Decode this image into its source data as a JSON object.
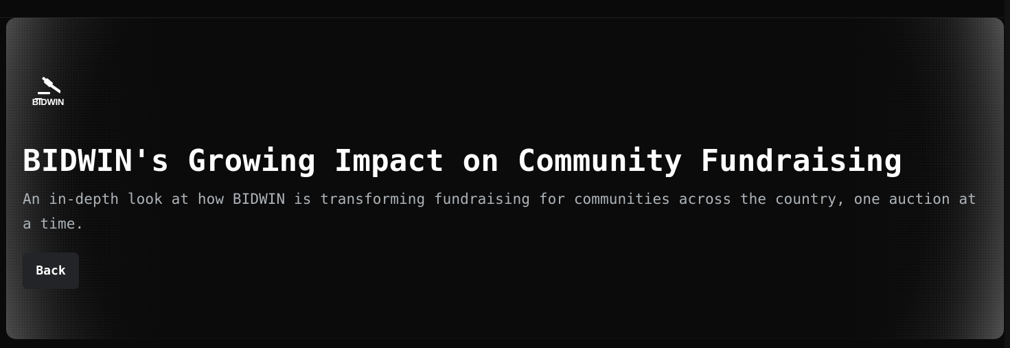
{
  "hero": {
    "logo_text": "BIDWIN",
    "title": "BIDWIN's Growing Impact on Community Fundraising",
    "subtitle": "An in-depth look at how BIDWIN is transforming fundraising for communities across the country, one auction at a time.",
    "back_label": "Back"
  },
  "icons": {
    "logo": "gavel-icon"
  },
  "colors": {
    "background": "#0b0b0b",
    "title": "#ffffff",
    "subtitle": "#aeb3b8",
    "button_background": "#222427",
    "button_text": "#ffffff"
  }
}
